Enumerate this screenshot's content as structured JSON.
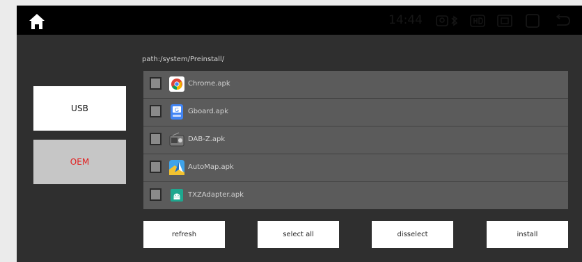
{
  "status_bar": {
    "time": "14:44",
    "icons": [
      "home-icon",
      "pin-icon",
      "bluetooth-icon",
      "hd-icon",
      "screen-icon",
      "window-icon",
      "back-icon"
    ]
  },
  "browser": {
    "path": "path:/system/Preinstall/"
  },
  "sources": {
    "usb_label": "USB",
    "oem_label": "OEM",
    "selected": "OEM"
  },
  "files": [
    {
      "name": "Chrome.apk",
      "icon": "chrome-icon",
      "checked": false
    },
    {
      "name": "Gboard.apk",
      "icon": "gboard-icon",
      "checked": false
    },
    {
      "name": "DAB-Z.apk",
      "icon": "radio-icon",
      "checked": false
    },
    {
      "name": "AutoMap.apk",
      "icon": "map-icon",
      "checked": false
    },
    {
      "name": "TXZAdapter.apk",
      "icon": "android-icon",
      "checked": false
    }
  ],
  "actions": {
    "refresh": "refresh",
    "select_all": "select all",
    "disselect": "disselect",
    "install": "install"
  },
  "colors": {
    "oem_text": "#e21d1d",
    "oem_bg": "#c6c6c6",
    "usb_bg": "#ffffff",
    "list_bg": "#5b5b5b",
    "panel_bg": "#2f2f2f"
  }
}
